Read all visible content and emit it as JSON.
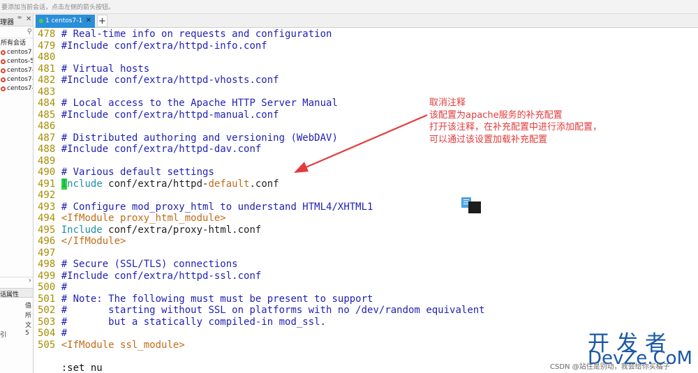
{
  "app": {
    "hint_text": "要添加当前会话，点击左侧的箭头按钮。"
  },
  "sidebar": {
    "title": "理器",
    "pin_icon": "pin-icon",
    "close_icon": "close-icon",
    "root_label": "所有会话",
    "sessions": [
      {
        "label": "centos7"
      },
      {
        "label": "centos-5"
      },
      {
        "label": "centos7-"
      },
      {
        "label": "centos7-"
      },
      {
        "label": "centos7-"
      }
    ],
    "properties_title": "话属性",
    "properties": [
      {
        "key": "",
        "value": "值"
      },
      {
        "key": "",
        "value": "所"
      },
      {
        "key": "",
        "value": "文"
      },
      {
        "key": "引",
        "value": "5"
      }
    ]
  },
  "tabs": {
    "items": [
      {
        "label": "1 centos7-1"
      }
    ],
    "add_label": "+"
  },
  "terminal": {
    "lines": [
      {
        "num": "478",
        "segs": [
          {
            "t": "# Real-time info on requests and configuration",
            "c": "cm"
          }
        ]
      },
      {
        "num": "479",
        "segs": [
          {
            "t": "#Include conf/extra/httpd-info.conf",
            "c": "cm"
          }
        ]
      },
      {
        "num": "480",
        "segs": []
      },
      {
        "num": "481",
        "segs": [
          {
            "t": "# Virtual hosts",
            "c": "cm"
          }
        ]
      },
      {
        "num": "482",
        "segs": [
          {
            "t": "#Include conf/extra/httpd-vhosts.conf",
            "c": "cm"
          }
        ]
      },
      {
        "num": "483",
        "segs": []
      },
      {
        "num": "484",
        "segs": [
          {
            "t": "# Local access to the Apache HTTP Server Manual",
            "c": "cm"
          }
        ]
      },
      {
        "num": "485",
        "segs": [
          {
            "t": "#Include conf/extra/httpd-manual.conf",
            "c": "cm"
          }
        ]
      },
      {
        "num": "486",
        "segs": []
      },
      {
        "num": "487",
        "segs": [
          {
            "t": "# Distributed authoring and versioning (WebDAV)",
            "c": "cm"
          }
        ]
      },
      {
        "num": "488",
        "segs": [
          {
            "t": "#Include conf/extra/httpd-dav.conf",
            "c": "cm"
          }
        ]
      },
      {
        "num": "489",
        "segs": []
      },
      {
        "num": "490",
        "segs": [
          {
            "t": "# Various default settings",
            "c": "cm"
          }
        ]
      },
      {
        "num": "491",
        "segs": [
          {
            "t": "I",
            "c": "cur"
          },
          {
            "t": "nclude",
            "c": "kw"
          },
          {
            "t": " conf/extra/httpd-",
            "c": "tx"
          },
          {
            "t": "default",
            "c": "hl"
          },
          {
            "t": ".conf",
            "c": "tx"
          }
        ]
      },
      {
        "num": "492",
        "segs": []
      },
      {
        "num": "493",
        "segs": [
          {
            "t": "# Configure mod_proxy_html to understand HTML4/XHTML1",
            "c": "cm"
          }
        ]
      },
      {
        "num": "494",
        "segs": [
          {
            "t": "<IfModule proxy_html_module>",
            "c": "hl"
          }
        ]
      },
      {
        "num": "495",
        "segs": [
          {
            "t": "Include",
            "c": "kw"
          },
          {
            "t": " conf/extra/proxy-html.conf",
            "c": "tx"
          }
        ]
      },
      {
        "num": "496",
        "segs": [
          {
            "t": "</IfModule>",
            "c": "hl"
          }
        ]
      },
      {
        "num": "497",
        "segs": []
      },
      {
        "num": "498",
        "segs": [
          {
            "t": "# Secure (SSL/TLS) connections",
            "c": "cm"
          }
        ]
      },
      {
        "num": "499",
        "segs": [
          {
            "t": "#Include conf/extra/httpd-ssl.conf",
            "c": "cm"
          }
        ]
      },
      {
        "num": "500",
        "segs": [
          {
            "t": "#",
            "c": "cm"
          }
        ]
      },
      {
        "num": "501",
        "segs": [
          {
            "t": "# Note: The following must must be present to support",
            "c": "cm"
          }
        ]
      },
      {
        "num": "502",
        "segs": [
          {
            "t": "#       starting without SSL on platforms with no /dev/random equivalent",
            "c": "cm"
          }
        ]
      },
      {
        "num": "503",
        "segs": [
          {
            "t": "#       but a statically compiled-in mod_ssl.",
            "c": "cm"
          }
        ]
      },
      {
        "num": "504",
        "segs": [
          {
            "t": "#",
            "c": "cm"
          }
        ]
      },
      {
        "num": "505",
        "segs": [
          {
            "t": "<IfModule ssl_module>",
            "c": "hl"
          }
        ]
      }
    ],
    "command": ":set nu",
    "position_fragment": "1",
    "colors": {
      "line_number": "#a68d00",
      "comment": "#1f1fb4",
      "keyword": "#1b8fa6",
      "highlight": "#c06b1a",
      "cursor": "#2cd92c"
    }
  },
  "annotation": {
    "lines": [
      "取消注释",
      "该配置为apache服务的补充配置",
      "打开该注释，在补充配置中进行添加配置，",
      "可以通过该设置加载补充配置"
    ],
    "color": "#e23b3b",
    "arrow_icon": "red-arrow-icon"
  },
  "overlay": {
    "float_icon": "chat-bubble-icon"
  },
  "watermark": {
    "line1": "开发者",
    "line2": "DevZe.CoM",
    "csdn": "CSDN @站住是别动，我会给你买橘子"
  }
}
